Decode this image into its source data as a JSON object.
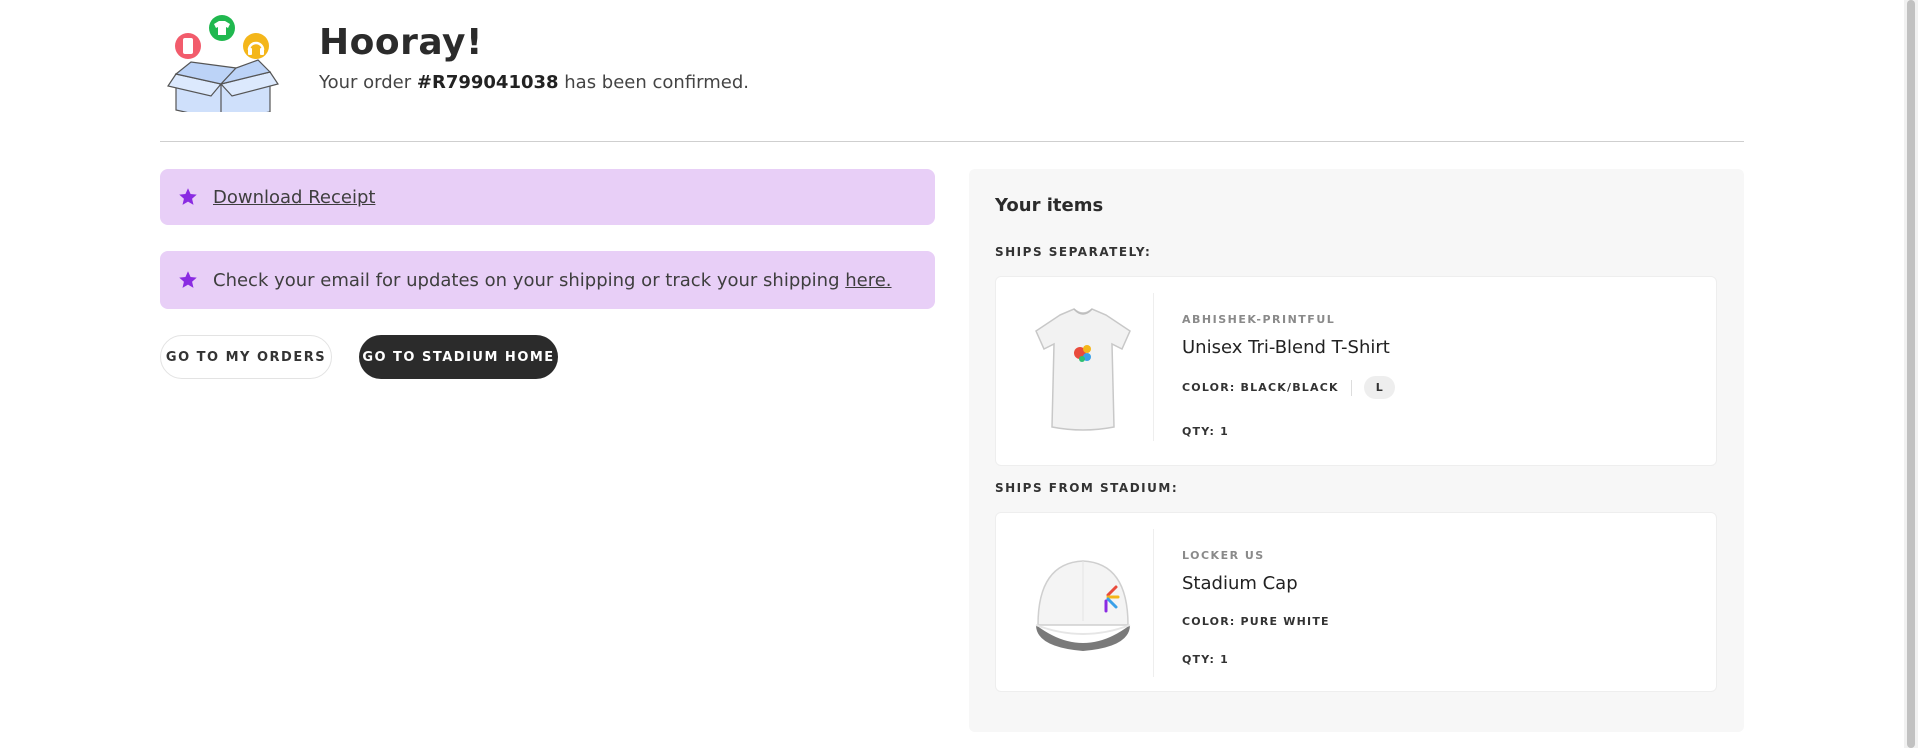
{
  "header": {
    "title": "Hooray!",
    "subtitle_prefix": "Your order ",
    "order_number": "#R799041038",
    "subtitle_suffix": " has been confirmed."
  },
  "notices": {
    "receipt_link": "Download Receipt",
    "shipping_text": "Check your email for updates on your shipping or track your shipping ",
    "shipping_link": "here."
  },
  "buttons": {
    "orders": "GO TO MY ORDERS",
    "home": "GO TO STADIUM HOME"
  },
  "items_panel": {
    "title": "Your items",
    "groups": [
      {
        "label": "SHIPS SEPARATELY:",
        "items": [
          {
            "brand": "ABHISHEK-PRINTFUL",
            "name": "Unisex Tri-Blend T-Shirt",
            "color": "COLOR: BLACK/BLACK",
            "size": "L",
            "qty": "QTY: 1"
          }
        ]
      },
      {
        "label": "SHIPS FROM STADIUM:",
        "items": [
          {
            "brand": "LOCKER US",
            "name": "Stadium Cap",
            "color": "COLOR: PURE WHITE",
            "qty": "QTY: 1"
          }
        ]
      }
    ]
  },
  "colors": {
    "notice_bg": "#e8cff7",
    "star": "#8a2be2",
    "primary_button": "#2b2b2b",
    "panel_bg": "#f7f7f7"
  }
}
